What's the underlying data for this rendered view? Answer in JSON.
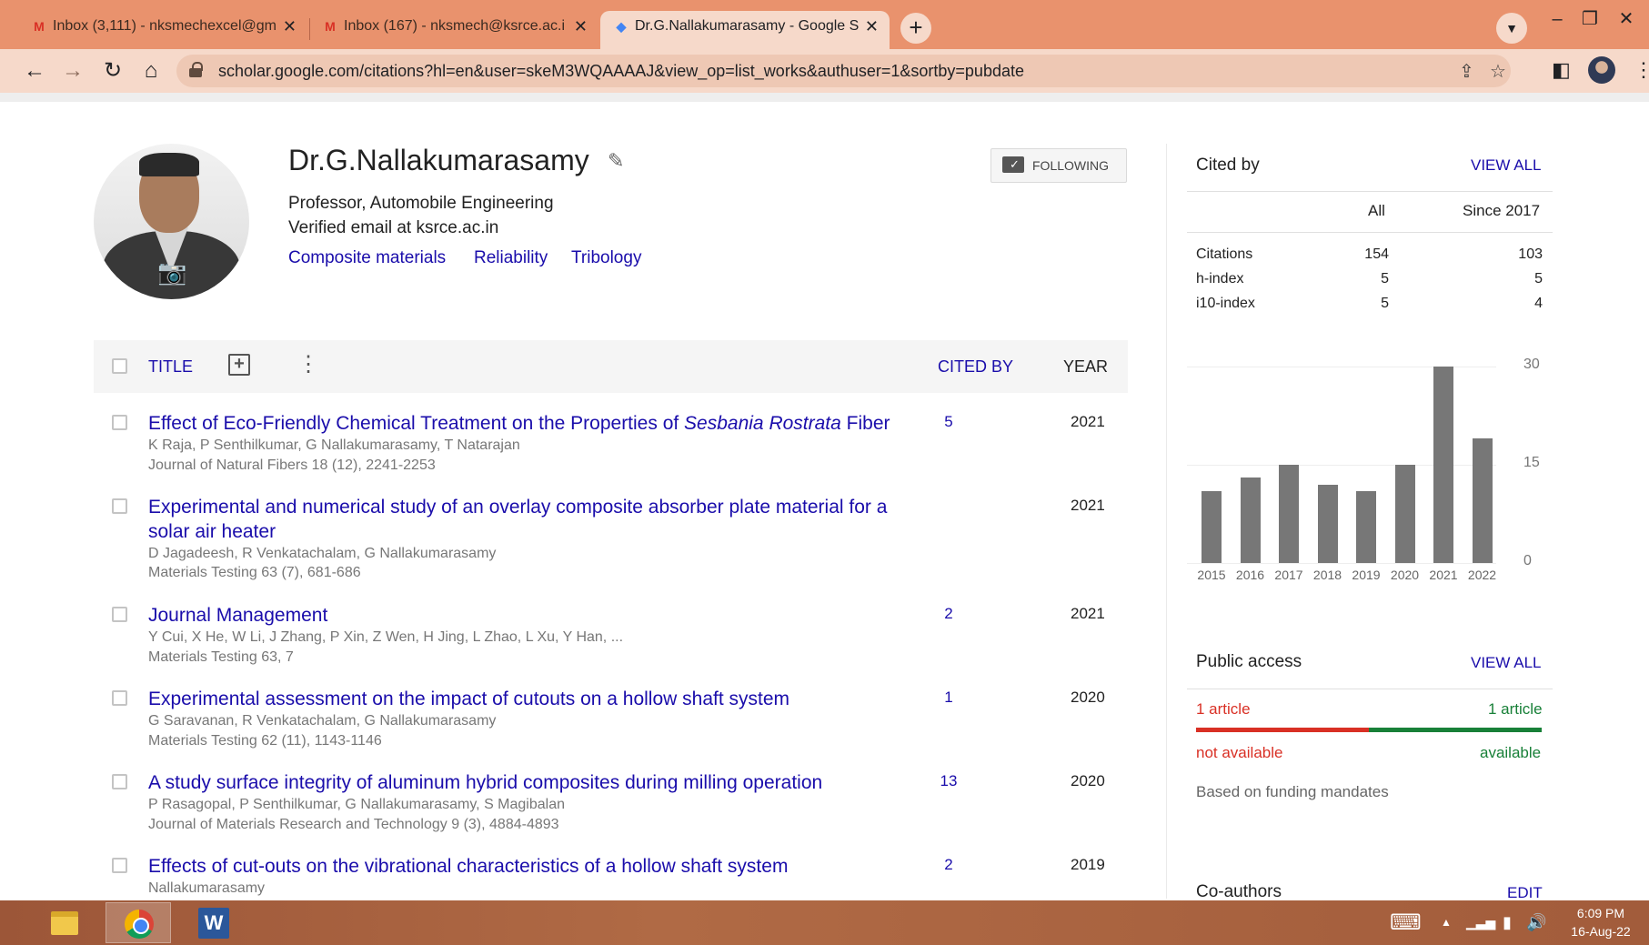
{
  "browser": {
    "tabs": [
      {
        "title": "Inbox (3,111) - nksmechexcel@gm",
        "icon": "gmail-icon"
      },
      {
        "title": "Inbox (167) - nksmech@ksrce.ac.i",
        "icon": "gmail-icon"
      },
      {
        "title": "Dr.G.Nallakumarasamy - Google S",
        "icon": "scholar-icon"
      }
    ],
    "url": "scholar.google.com/citations?hl=en&user=skeM3WQAAAAJ&view_op=list_works&authuser=1&sortby=pubdate"
  },
  "profile": {
    "name": "Dr.G.Nallakumarasamy",
    "affiliation": "Professor, Automobile Engineering",
    "email": "Verified email at ksrce.ac.in",
    "interests": [
      "Composite materials",
      "Reliability",
      "Tribology"
    ],
    "follow_label": "FOLLOWING"
  },
  "table": {
    "title_header": "TITLE",
    "cited_header": "CITED BY",
    "year_header": "YEAR"
  },
  "articles": [
    {
      "title_pre": "Effect of Eco-Friendly Chemical Treatment on the Properties of ",
      "title_italic": "Sesbania Rostrata",
      "title_post": " Fiber",
      "authors": "K Raja, P Senthilkumar, G Nallakumarasamy, T Natarajan",
      "venue": "Journal of Natural Fibers 18 (12), 2241-2253",
      "cited": "5",
      "year": "2021"
    },
    {
      "title_pre": "Experimental and numerical study of an overlay composite absorber plate material for a solar air heater",
      "title_italic": "",
      "title_post": "",
      "authors": "D Jagadeesh, R Venkatachalam, G Nallakumarasamy",
      "venue": "Materials Testing 63 (7), 681-686",
      "cited": "",
      "year": "2021"
    },
    {
      "title_pre": "Journal Management",
      "title_italic": "",
      "title_post": "",
      "authors": "Y Cui, X He, W Li, J Zhang, P Xin, Z Wen, H Jing, L Zhao, L Xu, Y Han, ...",
      "venue": "Materials Testing 63, 7",
      "cited": "2",
      "year": "2021"
    },
    {
      "title_pre": "Experimental assessment on the impact of cutouts on a hollow shaft system",
      "title_italic": "",
      "title_post": "",
      "authors": "G Saravanan, R Venkatachalam, G Nallakumarasamy",
      "venue": "Materials Testing 62 (11), 1143-1146",
      "cited": "1",
      "year": "2020"
    },
    {
      "title_pre": "A study surface integrity of aluminum hybrid composites during milling operation",
      "title_italic": "",
      "title_post": "",
      "authors": "P Rasagopal, P Senthilkumar, G Nallakumarasamy, S Magibalan",
      "venue": "Journal of Materials Research and Technology 9 (3), 4884-4893",
      "cited": "13",
      "year": "2020"
    },
    {
      "title_pre": "Effects of cut-outs on the vibrational characteristics of a hollow shaft system",
      "title_italic": "",
      "title_post": "",
      "authors": "Nallakumarasamy",
      "venue": "",
      "cited": "2",
      "year": "2019"
    }
  ],
  "cited_by": {
    "heading": "Cited by",
    "view_all": "VIEW ALL",
    "col_all": "All",
    "col_since": "Since 2017",
    "rows": [
      {
        "label": "Citations",
        "all": "154",
        "since": "103"
      },
      {
        "label": "h-index",
        "all": "5",
        "since": "5"
      },
      {
        "label": "i10-index",
        "all": "5",
        "since": "4"
      }
    ]
  },
  "chart_data": {
    "type": "bar",
    "categories": [
      "2015",
      "2016",
      "2017",
      "2018",
      "2019",
      "2020",
      "2021",
      "2022"
    ],
    "values": [
      11,
      13,
      15,
      12,
      11,
      15,
      30,
      19
    ],
    "ylim": [
      0,
      30
    ],
    "yticks": [
      "30",
      "15",
      "0"
    ],
    "bar_color": "#777777"
  },
  "public_access": {
    "heading": "Public access",
    "view_all": "VIEW ALL",
    "not_available_count": "1 article",
    "available_count": "1 article",
    "not_available_label": "not available",
    "available_label": "available",
    "note": "Based on funding mandates"
  },
  "coauthors": {
    "heading": "Co-authors",
    "edit": "EDIT"
  },
  "taskbar": {
    "time": "6:09 PM",
    "date": "16-Aug-22"
  }
}
